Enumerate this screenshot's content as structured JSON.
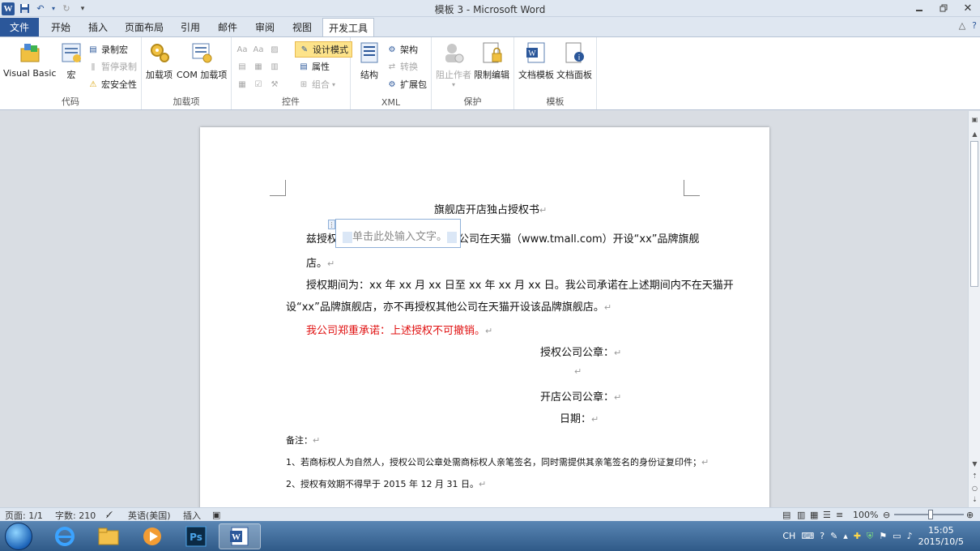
{
  "window": {
    "title": "模板 3  -  Microsoft Word",
    "minimize_icon": "minimize-icon",
    "maximize_icon": "restore-icon",
    "close_icon": "close-icon"
  },
  "tabs": {
    "file": "文件",
    "items": [
      "开始",
      "插入",
      "页面布局",
      "引用",
      "邮件",
      "审阅",
      "视图",
      "开发工具"
    ],
    "active": "开发工具"
  },
  "ribbon": {
    "code": {
      "label": "代码",
      "visual_basic": "Visual Basic",
      "macros": "宏",
      "record_macro": "录制宏",
      "pause_recording": "暂停录制",
      "macro_security": "宏安全性"
    },
    "addins": {
      "label": "加载项",
      "addins": "加载项",
      "com_addins": "COM 加载项"
    },
    "controls": {
      "label": "控件",
      "design_mode": "设计模式",
      "properties": "属性",
      "group": "组合"
    },
    "xml": {
      "label": "XML",
      "structure": "结构",
      "schema": "架构",
      "transform": "转换",
      "expansion_packs": "扩展包"
    },
    "protect": {
      "label": "保护",
      "block_authors": "阻止作者",
      "restrict_editing": "限制编辑"
    },
    "templates": {
      "label": "模板",
      "document_template": "文档模板",
      "document_panel": "文档面板"
    }
  },
  "document": {
    "title": "旗舰店开店独占授权书",
    "para1_start": "兹授权",
    "content_control_placeholder": "单击此处输入文字。",
    "para1_rest": "公司在天猫（www.tmall.com）开设“xx”品牌旗舰",
    "para1_line2": "店。",
    "para2_line1": "授权期间为：xx 年 xx 月 xx 日至 xx 年 xx 月 xx 日。我公司承诺在上述期间内不在天猫开",
    "para2_line2": "设“xx”品牌旗舰店，亦不再授权其他公司在天猫开设该品牌旗舰店。",
    "para3": "我公司郑重承诺：上述授权不可撤销。",
    "seal1": "授权公司公章：",
    "seal2": "开店公司公章：",
    "date": "日期：",
    "notes_label": "备注：",
    "note1": "1、若商标权人为自然人，授权公司公章处需商标权人亲笔签名，同时需提供其亲笔签名的身份证复印件；",
    "note2": "2、授权有效期不得早于 2015 年 12 月 31 日。",
    "para_mark": "↵"
  },
  "status": {
    "page": "页面: 1/1",
    "words": "字数: 210",
    "language": "英语(美国)",
    "insert_mode": "插入",
    "zoom": "100%"
  },
  "taskbar": {
    "clock_time": "15:05",
    "clock_date": "2015/10/5",
    "ime": "CH"
  },
  "colors": {
    "accent": "#2b579a",
    "red_text": "#e01010"
  }
}
